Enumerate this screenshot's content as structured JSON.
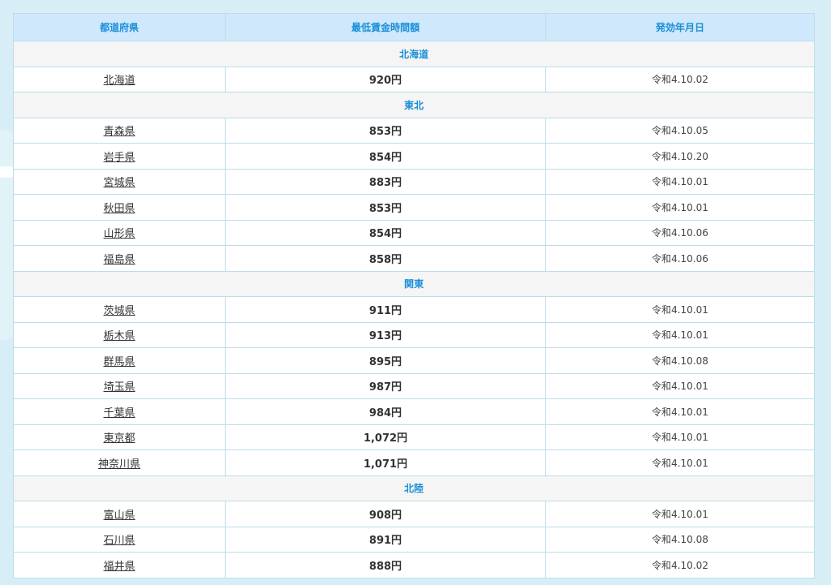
{
  "table": {
    "headers": [
      "都道府県",
      "最低賃金時間額",
      "発効年月日"
    ],
    "groups": [
      {
        "region": "北海道",
        "rows": [
          {
            "pref": "北海道",
            "wage": "920円",
            "date": "令和4.10.02"
          }
        ]
      },
      {
        "region": "東北",
        "rows": [
          {
            "pref": "青森県",
            "wage": "853円",
            "date": "令和4.10.05"
          },
          {
            "pref": "岩手県",
            "wage": "854円",
            "date": "令和4.10.20"
          },
          {
            "pref": "宮城県",
            "wage": "883円",
            "date": "令和4.10.01"
          },
          {
            "pref": "秋田県",
            "wage": "853円",
            "date": "令和4.10.01"
          },
          {
            "pref": "山形県",
            "wage": "854円",
            "date": "令和4.10.06"
          },
          {
            "pref": "福島県",
            "wage": "858円",
            "date": "令和4.10.06"
          }
        ]
      },
      {
        "region": "関東",
        "rows": [
          {
            "pref": "茨城県",
            "wage": "911円",
            "date": "令和4.10.01"
          },
          {
            "pref": "栃木県",
            "wage": "913円",
            "date": "令和4.10.01"
          },
          {
            "pref": "群馬県",
            "wage": "895円",
            "date": "令和4.10.08"
          },
          {
            "pref": "埼玉県",
            "wage": "987円",
            "date": "令和4.10.01"
          },
          {
            "pref": "千葉県",
            "wage": "984円",
            "date": "令和4.10.01"
          },
          {
            "pref": "東京都",
            "wage": "1,072円",
            "date": "令和4.10.01"
          },
          {
            "pref": "神奈川県",
            "wage": "1,071円",
            "date": "令和4.10.01"
          }
        ]
      },
      {
        "region": "北陸",
        "rows": [
          {
            "pref": "富山県",
            "wage": "908円",
            "date": "令和4.10.01"
          },
          {
            "pref": "石川県",
            "wage": "891円",
            "date": "令和4.10.08"
          },
          {
            "pref": "福井県",
            "wage": "888円",
            "date": "令和4.10.02"
          }
        ]
      }
    ]
  }
}
